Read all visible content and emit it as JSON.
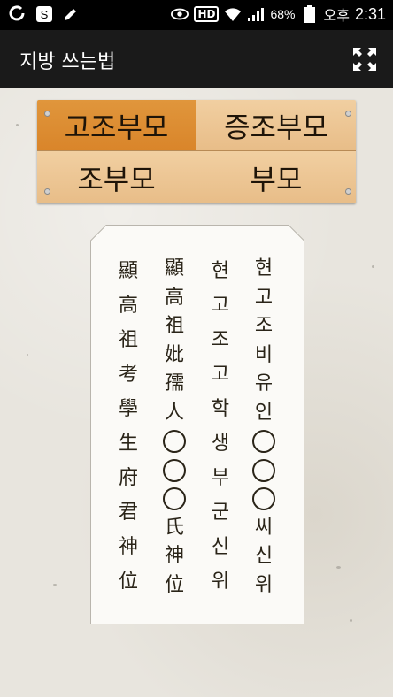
{
  "statusbar": {
    "battery": "68%",
    "ampm": "오후",
    "time": "2:31",
    "hd": "HD"
  },
  "appbar": {
    "title": "지방 쓰는법"
  },
  "tabs": [
    {
      "label": "고조부모",
      "active": true
    },
    {
      "label": "증조부모",
      "active": false
    },
    {
      "label": "조부모",
      "active": false
    },
    {
      "label": "부모",
      "active": false
    }
  ],
  "jibang": {
    "columns": [
      {
        "name": "col-hanja-grandfather",
        "chars": [
          "顯",
          "高",
          "祖",
          "考",
          "學",
          "生",
          "府",
          "君",
          "神",
          "位"
        ]
      },
      {
        "name": "col-hanja-grandmother",
        "chars": [
          "顯",
          "高",
          "祖",
          "妣",
          "孺",
          "人",
          "○",
          "○",
          "○",
          "氏",
          "神",
          "位"
        ]
      },
      {
        "name": "col-hangul-grandfather",
        "chars": [
          "현",
          "고",
          "조",
          "고",
          "학",
          "생",
          "부",
          "군",
          "신",
          "위"
        ]
      },
      {
        "name": "col-hangul-grandmother",
        "chars": [
          "현",
          "고",
          "조",
          "비",
          "유",
          "인",
          "○",
          "○",
          "○",
          "씨",
          "신",
          "위"
        ]
      }
    ]
  },
  "colors": {
    "active_tab": "#d9852a",
    "inactive_tab": "#ecc590",
    "appbar": "#1a1a1a"
  }
}
